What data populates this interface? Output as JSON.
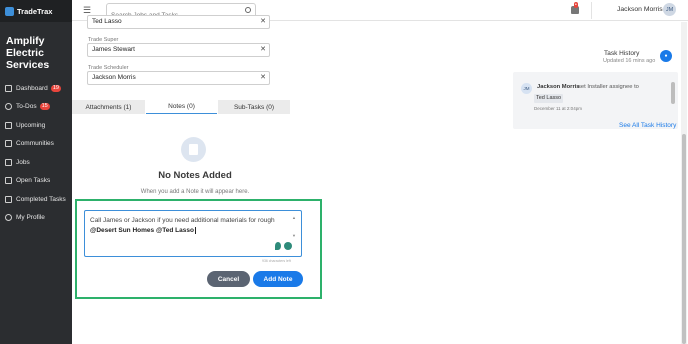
{
  "app": {
    "brand": "TradeTrax",
    "company": "Amplify Electric Services"
  },
  "sidebar": {
    "items": [
      {
        "label": "Dashboard",
        "badge": "19"
      },
      {
        "label": "To-Dos",
        "badge": "15"
      },
      {
        "label": "Upcoming",
        "badge": ""
      },
      {
        "label": "Communities",
        "badge": ""
      },
      {
        "label": "Jobs",
        "badge": ""
      },
      {
        "label": "Open Tasks",
        "badge": ""
      },
      {
        "label": "Completed Tasks",
        "badge": ""
      },
      {
        "label": "My Profile",
        "badge": ""
      }
    ]
  },
  "topbar": {
    "search_placeholder": "Search Jobs and Tasks",
    "user_name": "Jackson Morris",
    "avatar_initials": "JM"
  },
  "form": {
    "field1_value": "Ted Lasso",
    "trade_super_label": "Trade Super",
    "trade_super_value": "James Stewart",
    "trade_scheduler_label": "Trade Scheduler",
    "trade_scheduler_value": "Jackson Morris"
  },
  "tabs": {
    "attachments": "Attachments (1)",
    "notes": "Notes (0)",
    "subtasks": "Sub-Tasks (0)"
  },
  "notes": {
    "empty_title": "No Notes Added",
    "empty_subtitle": "When you add a Note it will appear here.",
    "editor_text": "Call James or Jackson if you need additional materials for rough",
    "editor_mentions": "@Desert Sun Homes @Ted Lasso",
    "char_count": "936 characters left",
    "cancel_label": "Cancel",
    "add_label": "Add Note"
  },
  "history": {
    "title": "Task History",
    "updated": "Updated 16 mins ago",
    "actor_initials": "JM",
    "actor": "Jackson Morris",
    "action": "set Installer assignee to",
    "target": "Ted Lasso",
    "date": "December 11 at 2:04pm",
    "see_all": "See All Task History"
  },
  "colors": {
    "accent": "#1a7ae8",
    "highlight": "#2db16b",
    "sidebar": "#2b2d30",
    "badge": "#e8453c"
  }
}
